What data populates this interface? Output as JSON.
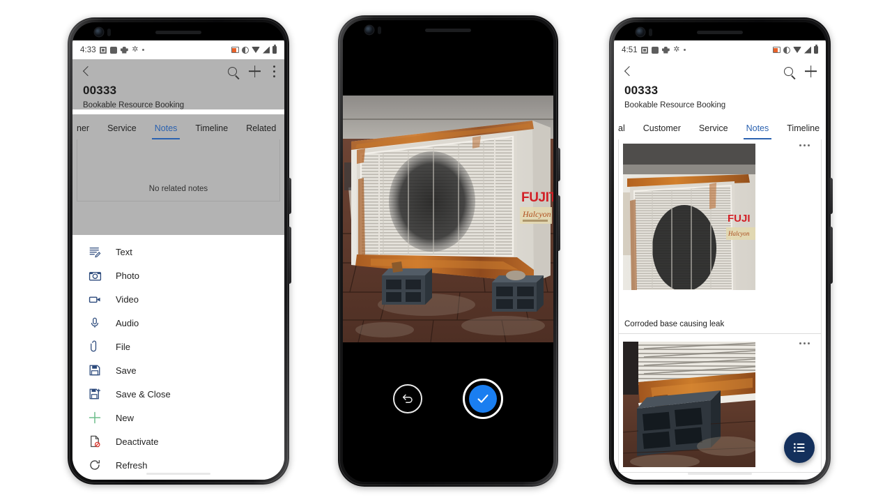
{
  "phones": {
    "left": {
      "name": "phone-left-menu",
      "statusbar": {
        "time": "4:33",
        "left_icons": [
          "image-notification-icon",
          "square-notification-icon",
          "puzzle-notification-icon",
          "snowflake-notification-icon",
          "dot-notification-icon"
        ],
        "right_icons": [
          "screencast-icon",
          "contrast-icon",
          "wifi-icon",
          "cellular-signal-icon",
          "battery-icon"
        ]
      },
      "header": {
        "back_icon": "back-chevron-icon",
        "record_id": "00333",
        "record_type": "Bookable Resource Booking",
        "actions": [
          "search-icon",
          "plus-icon",
          "overflow-menu-icon"
        ]
      },
      "tabs": [
        {
          "label": "ner",
          "active": false,
          "clipped": true
        },
        {
          "label": "Service",
          "active": false
        },
        {
          "label": "Notes",
          "active": true
        },
        {
          "label": "Timeline",
          "active": false
        },
        {
          "label": "Related",
          "active": false
        }
      ],
      "empty_state": "No related notes",
      "menu_items": [
        {
          "label": "Text",
          "icon": "text-note-icon"
        },
        {
          "label": "Photo",
          "icon": "camera-icon"
        },
        {
          "label": "Video",
          "icon": "video-camera-icon"
        },
        {
          "label": "Audio",
          "icon": "microphone-icon"
        },
        {
          "label": "File",
          "icon": "paperclip-icon"
        },
        {
          "label": "Save",
          "icon": "save-disk-icon"
        },
        {
          "label": "Save & Close",
          "icon": "save-and-close-icon"
        },
        {
          "label": "New",
          "icon": "plus-icon"
        },
        {
          "label": "Deactivate",
          "icon": "deactivate-document-icon"
        },
        {
          "label": "Refresh",
          "icon": "refresh-icon"
        }
      ]
    },
    "center": {
      "name": "phone-center-camera",
      "photo_alt": "Rusted Fujitsu Halcyon outdoor AC condenser unit on brick patio riser blocks",
      "controls": [
        {
          "label": "Retake",
          "icon": "undo-arrow-icon"
        },
        {
          "label": "Accept",
          "icon": "checkmark-icon"
        }
      ],
      "accent_color": "#1a7ef0"
    },
    "right": {
      "name": "phone-right-notes",
      "statusbar": {
        "time": "4:51",
        "left_icons": [
          "image-notification-icon",
          "square-notification-icon",
          "puzzle-notification-icon",
          "snowflake-notification-icon",
          "dot-notification-icon"
        ],
        "right_icons": [
          "screencast-icon",
          "contrast-icon",
          "wifi-icon",
          "cellular-signal-icon",
          "battery-icon"
        ]
      },
      "header": {
        "back_icon": "back-chevron-icon",
        "record_id": "00333",
        "record_type": "Bookable Resource Booking",
        "actions": [
          "search-icon",
          "plus-icon"
        ]
      },
      "tabs": [
        {
          "label": "al",
          "active": false,
          "clipped": true
        },
        {
          "label": "Customer",
          "active": false
        },
        {
          "label": "Service",
          "active": false
        },
        {
          "label": "Notes",
          "active": true
        },
        {
          "label": "Timeline",
          "active": false
        }
      ],
      "notes": [
        {
          "caption": "Corroded base causing leak",
          "thumb_alt": "Rusted AC condenser grille close up",
          "more_icon": "overflow-menu-icon"
        },
        {
          "caption": "",
          "thumb_alt": "Rusted AC base sitting on dark riser blocks",
          "more_icon": "overflow-menu-icon"
        }
      ],
      "fab": {
        "icon": "list-menu-icon",
        "color": "#14305c"
      }
    }
  },
  "theme": {
    "accent_blue": "#2b62b0",
    "scrim_gray": "#b3b3b3",
    "camera_blue": "#1a7ef0",
    "fab_navy": "#14305c"
  }
}
